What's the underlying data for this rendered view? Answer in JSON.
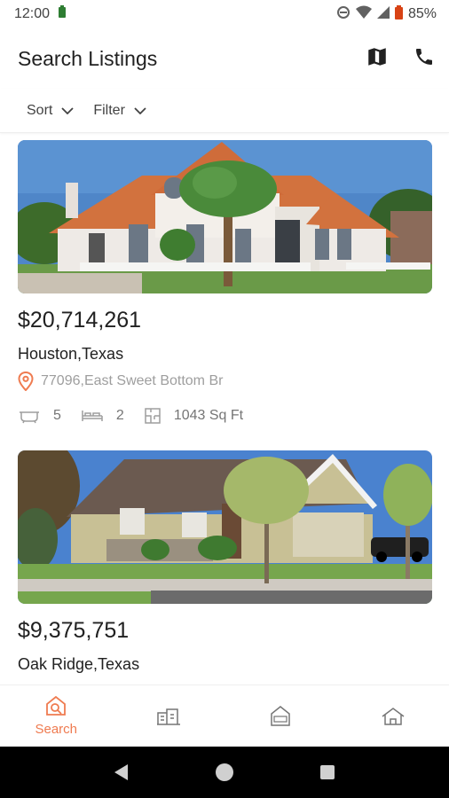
{
  "status_bar": {
    "time": "12:00",
    "battery": "85%"
  },
  "header": {
    "title": "Search Listings",
    "actions": [
      "map-icon",
      "phone-icon"
    ]
  },
  "toolbar": {
    "sort_label": "Sort",
    "filter_label": "Filter"
  },
  "listings": [
    {
      "price": "$20,714,261",
      "city": "Houston,Texas",
      "address": "77096,East Sweet Bottom Br",
      "baths": "5",
      "beds": "2",
      "area": "1043 Sq Ft"
    },
    {
      "price": "$9,375,751",
      "city": "Oak Ridge,Texas"
    }
  ],
  "bottom_nav": [
    {
      "label": "Search",
      "icon": "search-home-icon",
      "active": true
    },
    {
      "label": "",
      "icon": "building-icon",
      "active": false
    },
    {
      "label": "",
      "icon": "new-home-icon",
      "active": false
    },
    {
      "label": "",
      "icon": "home-outline-icon",
      "active": false
    }
  ],
  "colors": {
    "accent": "#ef7b50",
    "text": "#212121",
    "muted": "#9e9e9e"
  }
}
